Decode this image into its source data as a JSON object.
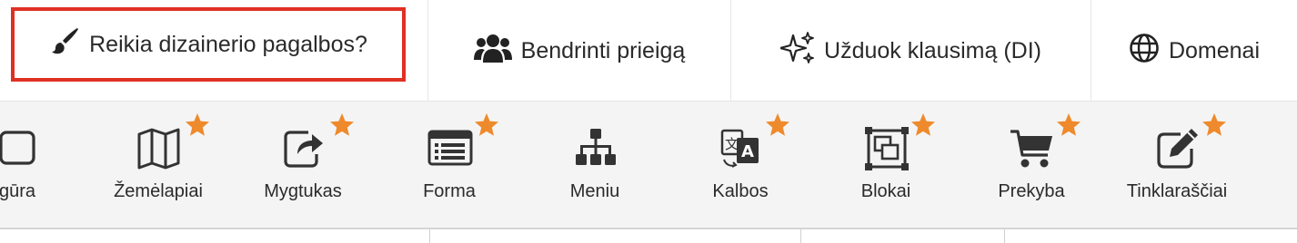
{
  "top_menu": {
    "designer_help": "Reikia dizainerio pagalbos?",
    "share_access": "Bendrinti prieigą",
    "ask_ai": "Užduok klausimą (DI)",
    "domains": "Domenai",
    "highlight_color": "#e03024"
  },
  "toolbar": {
    "star_color": "#ee8a2c",
    "items": [
      {
        "label": "gūra",
        "icon": "square-icon",
        "pro": false
      },
      {
        "label": "Žemėlapiai",
        "icon": "map-icon",
        "pro": true
      },
      {
        "label": "Mygtukas",
        "icon": "share-button-icon",
        "pro": true
      },
      {
        "label": "Forma",
        "icon": "form-icon",
        "pro": true
      },
      {
        "label": "Meniu",
        "icon": "sitemap-icon",
        "pro": false
      },
      {
        "label": "Kalbos",
        "icon": "language-icon",
        "pro": true
      },
      {
        "label": "Blokai",
        "icon": "blocks-icon",
        "pro": true
      },
      {
        "label": "Prekyba",
        "icon": "cart-icon",
        "pro": true
      },
      {
        "label": "Tinklaraščiai",
        "icon": "edit-icon",
        "pro": true
      }
    ]
  }
}
